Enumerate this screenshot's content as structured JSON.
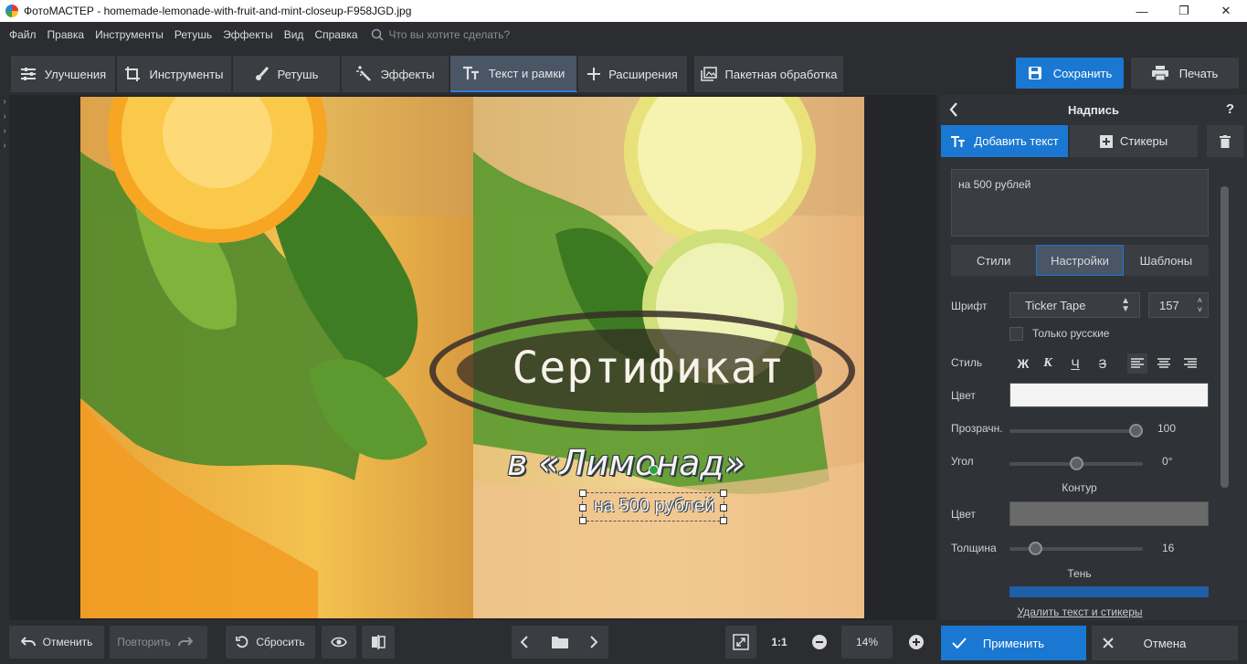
{
  "window": {
    "title": "ФотоМАСТЕР - homemade-lemonade-with-fruit-and-mint-closeup-F958JGD.jpg"
  },
  "menu": {
    "items": [
      "Файл",
      "Правка",
      "Инструменты",
      "Ретушь",
      "Эффекты",
      "Вид",
      "Справка"
    ],
    "search_placeholder": "Что вы хотите сделать?"
  },
  "tabs": [
    "Улучшения",
    "Инструменты",
    "Ретушь",
    "Эффекты",
    "Текст и рамки",
    "Расширения",
    "Пакетная обработка"
  ],
  "actions": {
    "save": "Сохранить",
    "print": "Печать"
  },
  "canvas": {
    "headline": "Сертификат",
    "subline": "в «Лимонад»",
    "selected_text": "на 500 рублей"
  },
  "panel": {
    "title": "Надпись",
    "help": "?",
    "add_text": "Добавить текст",
    "stickers": "Стикеры",
    "text_value": "на 500 рублей",
    "subtabs": [
      "Стили",
      "Настройки",
      "Шаблоны"
    ],
    "font_label": "Шрифт",
    "font_value": "Ticker Tape",
    "font_size": "157",
    "only_russian": "Только русские",
    "style_label": "Стиль",
    "style_buttons": [
      "Ж",
      "К",
      "Ч",
      "З"
    ],
    "color_label": "Цвет",
    "opacity_label": "Прозрачн.",
    "opacity_value": "100",
    "opacity_fraction": 1.0,
    "angle_label": "Угол",
    "angle_value": "0°",
    "angle_fraction": 0.5,
    "contour_header": "Контур",
    "contour_color_label": "Цвет",
    "thickness_label": "Толщина",
    "thickness_value": "16",
    "thickness_fraction": 0.16,
    "shadow_header": "Тень",
    "delete_link": "Удалить текст и стикеры",
    "text_color": "#f4f4f4",
    "contour_color": "#6a6a6a",
    "shadow_color": "#1f5fa8"
  },
  "bottom": {
    "undo": "Отменить",
    "redo": "Повторить",
    "reset": "Сбросить",
    "ratio": "1:1",
    "zoom": "14%",
    "apply": "Применить",
    "cancel": "Отмена"
  }
}
